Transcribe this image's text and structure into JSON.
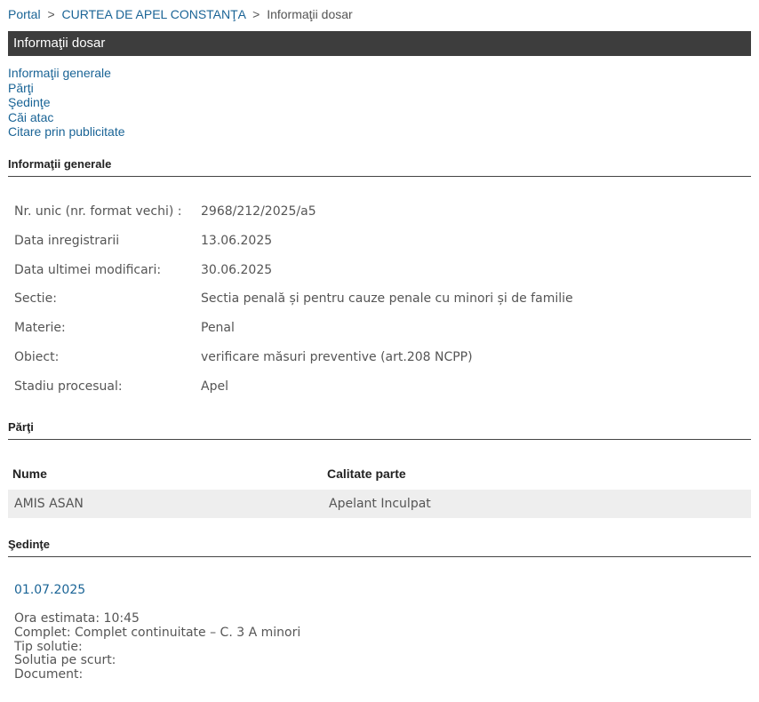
{
  "breadcrumb": {
    "home": "Portal",
    "separator": ">",
    "court": "CURTEA DE APEL CONSTANŢA",
    "current": "Informaţii dosar"
  },
  "page_title": "Informaţii dosar",
  "toc": [
    "Informaţii generale",
    "Părţi",
    "Şedinţe",
    "Căi atac",
    "Citare prin publicitate"
  ],
  "general": {
    "heading": "Informaţii generale",
    "rows": [
      {
        "label": "Nr. unic (nr. format vechi) :",
        "value": "2968/212/2025/a5"
      },
      {
        "label": "Data inregistrarii",
        "value": "13.06.2025"
      },
      {
        "label": "Data ultimei modificari:",
        "value": "30.06.2025"
      },
      {
        "label": "Sectie:",
        "value": "Sectia penală și pentru cauze penale cu minori și de familie"
      },
      {
        "label": "Materie:",
        "value": "Penal"
      },
      {
        "label": "Obiect:",
        "value": "verificare măsuri preventive (art.208 NCPP)"
      },
      {
        "label": "Stadiu procesual:",
        "value": "Apel"
      }
    ]
  },
  "parti": {
    "heading": "Părţi",
    "columns": [
      "Nume",
      "Calitate parte"
    ],
    "rows": [
      {
        "nume": "AMIS ASAN",
        "calitate": "Apelant Inculpat"
      }
    ]
  },
  "sedinte": {
    "heading": "Şedinţe",
    "date": "01.07.2025",
    "lines": [
      "Ora estimata: 10:45",
      "Complet: Complet continuitate – C. 3 A minori",
      "Tip solutie:",
      "Solutia pe scurt:",
      "Document:"
    ]
  }
}
